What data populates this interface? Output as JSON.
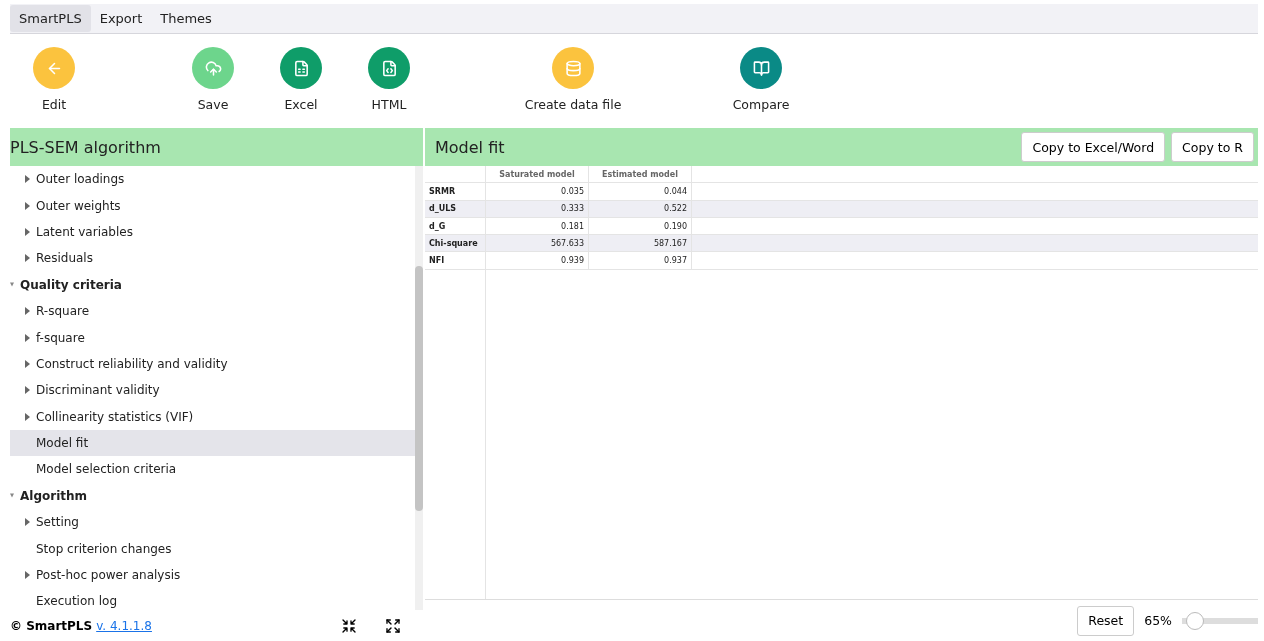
{
  "menu": [
    {
      "label": "SmartPLS",
      "selected": true
    },
    {
      "label": "Export",
      "selected": false
    },
    {
      "label": "Themes",
      "selected": false
    }
  ],
  "toolbar": {
    "groups": [
      [
        {
          "label": "Edit",
          "color": "#fbc33e"
        }
      ],
      [
        {
          "label": "Save",
          "color": "#6dd58c"
        },
        {
          "label": "Excel",
          "color": "#0f9d69"
        },
        {
          "label": "HTML",
          "color": "#0f9d69"
        }
      ],
      [
        {
          "label": "Create data file",
          "color": "#fbc33e"
        }
      ],
      [
        {
          "label": "Compare",
          "color": "#0a8a86"
        }
      ]
    ]
  },
  "left_panel": {
    "title": "PLS-SEM algorithm",
    "tree": [
      {
        "kind": "item",
        "label": "Outer loadings",
        "expandable": true,
        "selected": false
      },
      {
        "kind": "item",
        "label": "Outer weights",
        "expandable": true,
        "selected": false
      },
      {
        "kind": "item",
        "label": "Latent variables",
        "expandable": true,
        "selected": false
      },
      {
        "kind": "item",
        "label": "Residuals",
        "expandable": true,
        "selected": false
      },
      {
        "kind": "group",
        "label": "Quality criteria",
        "expanded": true,
        "children": [
          {
            "kind": "item",
            "label": "R-square",
            "expandable": true,
            "selected": false
          },
          {
            "kind": "item",
            "label": "f-square",
            "expandable": true,
            "selected": false
          },
          {
            "kind": "item",
            "label": "Construct reliability and validity",
            "expandable": true,
            "selected": false
          },
          {
            "kind": "item",
            "label": "Discriminant validity",
            "expandable": true,
            "selected": false
          },
          {
            "kind": "item",
            "label": "Collinearity statistics (VIF)",
            "expandable": true,
            "selected": false
          },
          {
            "kind": "item",
            "label": "Model fit",
            "expandable": false,
            "selected": true
          },
          {
            "kind": "item",
            "label": "Model selection criteria",
            "expandable": false,
            "selected": false
          }
        ]
      },
      {
        "kind": "group",
        "label": "Algorithm",
        "expanded": true,
        "children": [
          {
            "kind": "item",
            "label": "Setting",
            "expandable": true,
            "selected": false
          },
          {
            "kind": "item",
            "label": "Stop criterion changes",
            "expandable": false,
            "selected": false
          },
          {
            "kind": "item",
            "label": "Post-hoc power analysis",
            "expandable": true,
            "selected": false
          },
          {
            "kind": "item",
            "label": "Execution log",
            "expandable": false,
            "selected": false
          }
        ]
      }
    ]
  },
  "right_panel": {
    "title": "Model fit",
    "buttons": [
      "Copy to Excel/Word",
      "Copy to R"
    ],
    "table": {
      "columns": [
        "Saturated model",
        "Estimated model"
      ],
      "rows": [
        {
          "label": "SRMR",
          "values": [
            "0.035",
            "0.044"
          ]
        },
        {
          "label": "d_ULS",
          "values": [
            "0.333",
            "0.522"
          ]
        },
        {
          "label": "d_G",
          "values": [
            "0.181",
            "0.190"
          ]
        },
        {
          "label": "Chi-square",
          "values": [
            "567.633",
            "587.167"
          ]
        },
        {
          "label": "NFI",
          "values": [
            "0.939",
            "0.937"
          ]
        }
      ]
    }
  },
  "footer": {
    "brand": "© SmartPLS",
    "version": "v. 4.1.1.8",
    "reset": "Reset",
    "zoom": "65%",
    "zoom_slider": {
      "level": 0.05
    }
  }
}
